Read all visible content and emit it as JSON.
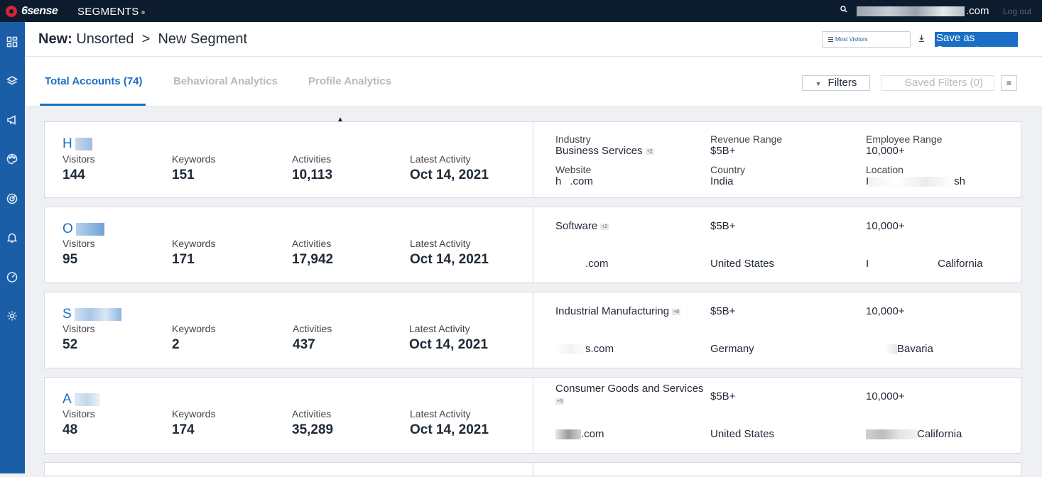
{
  "topbar": {
    "brand": "6sense",
    "app_title": "SEGMENTS",
    "email_suffix": ".com",
    "logout": "Log out"
  },
  "sidebar": {
    "icons": [
      "dashboard-icon",
      "layers-icon",
      "megaphone-icon",
      "palette-icon",
      "radar-icon",
      "bell-icon",
      "gauge-icon",
      "gear-icon"
    ]
  },
  "header": {
    "crumb_bold": "New:",
    "crumb_folder": "Unsorted",
    "crumb_sep": ">",
    "crumb_page": "New Segment",
    "sort_value": "Most Visitors",
    "save_label": "Save as Segment"
  },
  "tabs": {
    "items": [
      "Total Accounts (74)",
      "Behavioral Analytics",
      "Profile Analytics"
    ],
    "filters": "Filters",
    "saved_filters": "Saved Filters (0)"
  },
  "accounts": [
    {
      "initial": "H",
      "visitors_label": "Visitors",
      "visitors": "144",
      "keywords_label": "Keywords",
      "keywords": "151",
      "activities_label": "Activities",
      "activities": "10,113",
      "latest_label": "Latest Activity",
      "latest": "Oct 14, 2021",
      "industry_label": "Industry",
      "industry": "Business Services",
      "industry_tag": "+2",
      "revenue_label": "Revenue Range",
      "revenue": "$5B+",
      "employee_label": "Employee Range",
      "employee": "10,000+",
      "website_label": "Website",
      "website_prefix": "h",
      "website_suffix": ".com",
      "country_label": "Country",
      "country": "India",
      "location_label": "Location",
      "location_prefix": "I",
      "location_suffix": "sh"
    },
    {
      "initial": "O",
      "visitors_label": "Visitors",
      "visitors": "95",
      "keywords_label": "Keywords",
      "keywords": "171",
      "activities_label": "Activities",
      "activities": "17,942",
      "latest_label": "Latest Activity",
      "latest": "Oct 14, 2021",
      "industry": "Software",
      "industry_tag": "+2",
      "revenue": "$5B+",
      "employee": "10,000+",
      "website_suffix": ".com",
      "country": "United States",
      "location_prefix": "I",
      "location_suffix": "California"
    },
    {
      "initial": "S",
      "visitors_label": "Visitors",
      "visitors": "52",
      "keywords_label": "Keywords",
      "keywords": "2",
      "activities_label": "Activities",
      "activities": "437",
      "latest_label": "Latest Activity",
      "latest": "Oct 14, 2021",
      "industry": "Industrial Manufacturing",
      "industry_tag": "+8",
      "revenue": "$5B+",
      "employee": "10,000+",
      "website_suffix": "s.com",
      "country": "Germany",
      "location_suffix": "Bavaria"
    },
    {
      "initial": "A",
      "visitors_label": "Visitors",
      "visitors": "48",
      "keywords_label": "Keywords",
      "keywords": "174",
      "activities_label": "Activities",
      "activities": "35,289",
      "latest_label": "Latest Activity",
      "latest": "Oct 14, 2021",
      "industry": "Consumer Goods and Services",
      "industry_tag": "+3",
      "revenue": "$5B+",
      "employee": "10,000+",
      "website_suffix": ".com",
      "country": "United States",
      "location_suffix": "California"
    }
  ],
  "colors": {
    "accent": "#1a6fc4",
    "topbar": "#0d1b2e",
    "sidebar": "#1a5ea8",
    "brand_red": "#d7223b"
  }
}
